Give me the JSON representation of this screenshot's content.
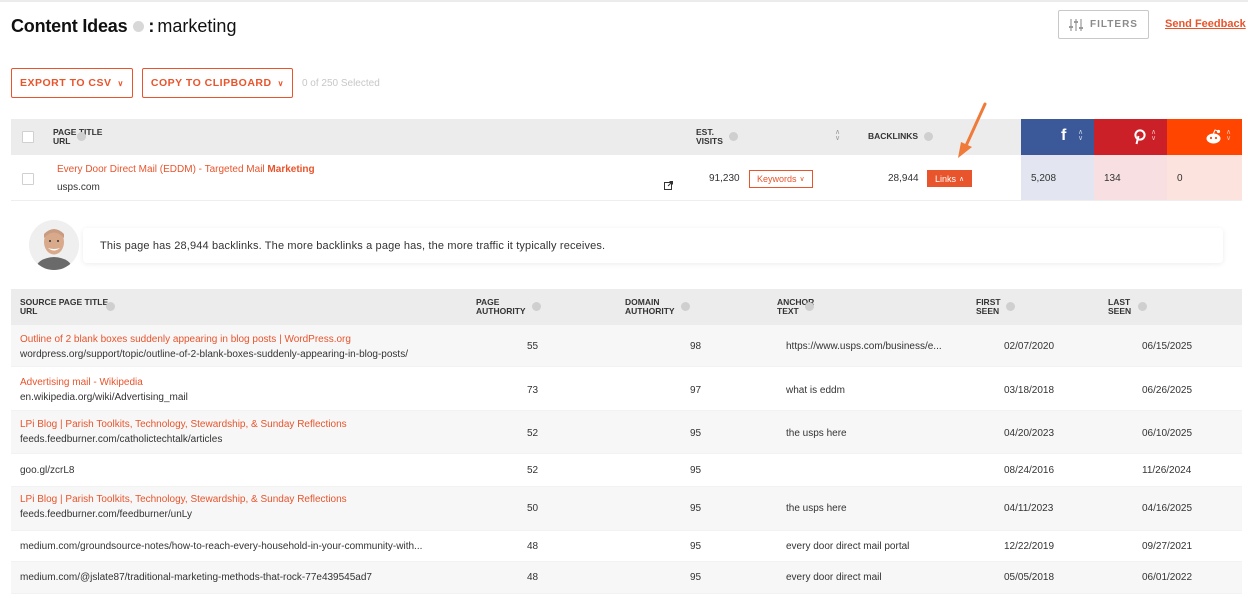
{
  "header": {
    "title": "Content Ideas",
    "colon": ":",
    "keyword": "marketing",
    "filters_label": "FILTERS",
    "send_feedback": "Send Feedback"
  },
  "actions": {
    "export_label": "EXPORT TO CSV",
    "copy_label": "COPY TO CLIPBOARD",
    "selected_text": "0 of 250 Selected"
  },
  "top_table": {
    "col_page_title": "PAGE TITLE",
    "col_url": "URL",
    "col_est": "EST.",
    "col_visits": "VISITS",
    "col_backlinks": "BACKLINKS",
    "row": {
      "title_prefix": "Every Door Direct Mail (EDDM) - Targeted Mail ",
      "title_bold": "Marketing",
      "url": "usps.com",
      "visits": "91,230",
      "keywords_label": "Keywords",
      "backlinks": "28,944",
      "links_label": "Links",
      "facebook": "5,208",
      "pinterest": "134",
      "reddit": "0"
    }
  },
  "colors": {
    "accent": "#e8542c",
    "facebook": "#3b5998",
    "pinterest": "#cb2027",
    "reddit": "#ff4500",
    "facebook_cell": "#e3e6f0",
    "pinterest_cell": "#f8e0e2",
    "reddit_cell": "#fde3dd"
  },
  "tip": {
    "text": "This page has 28,944 backlinks. The more backlinks a page has, the more traffic it typically receives."
  },
  "backlinks_table": {
    "headers": {
      "source_title": "SOURCE PAGE TITLE",
      "source_url": "URL",
      "pa_1": "PAGE",
      "pa_2": "AUTHORITY",
      "da_1": "DOMAIN",
      "da_2": "AUTHORITY",
      "anchor_1": "ANCHOR",
      "anchor_2": "TEXT",
      "first_1": "FIRST",
      "first_2": "SEEN",
      "last_1": "LAST",
      "last_2": "SEEN"
    },
    "rows": [
      {
        "title": "Outline of 2 blank boxes suddenly appearing in blog posts | WordPress.org",
        "url": "wordpress.org/support/topic/outline-of-2-blank-boxes-suddenly-appearing-in-blog-posts/",
        "pa": "55",
        "da": "98",
        "anchor": "https://www.usps.com/business/e...",
        "first": "02/07/2020",
        "last": "06/15/2025"
      },
      {
        "title": "Advertising mail - Wikipedia",
        "url": "en.wikipedia.org/wiki/Advertising_mail",
        "pa": "73",
        "da": "97",
        "anchor": "what is eddm",
        "first": "03/18/2018",
        "last": "06/26/2025"
      },
      {
        "title": "LPi Blog | Parish Toolkits, Technology, Stewardship, & Sunday Reflections",
        "url": "feeds.feedburner.com/catholictechtalk/articles",
        "pa": "52",
        "da": "95",
        "anchor": "the usps here",
        "first": "04/20/2023",
        "last": "06/10/2025"
      },
      {
        "title": "",
        "url": "goo.gl/zcrL8",
        "pa": "52",
        "da": "95",
        "anchor": "",
        "first": "08/24/2016",
        "last": "11/26/2024"
      },
      {
        "title": "LPi Blog | Parish Toolkits, Technology, Stewardship, & Sunday Reflections",
        "url": "feeds.feedburner.com/feedburner/unLy",
        "pa": "50",
        "da": "95",
        "anchor": "the usps here",
        "first": "04/11/2023",
        "last": "04/16/2025"
      },
      {
        "title": "",
        "url": "medium.com/groundsource-notes/how-to-reach-every-household-in-your-community-with...",
        "pa": "48",
        "da": "95",
        "anchor": "every door direct mail portal",
        "first": "12/22/2019",
        "last": "09/27/2021"
      },
      {
        "title": "",
        "url": "medium.com/@jslate87/traditional-marketing-methods-that-rock-77e439545ad7",
        "pa": "48",
        "da": "95",
        "anchor": "every door direct mail",
        "first": "05/05/2018",
        "last": "06/01/2022"
      }
    ]
  }
}
